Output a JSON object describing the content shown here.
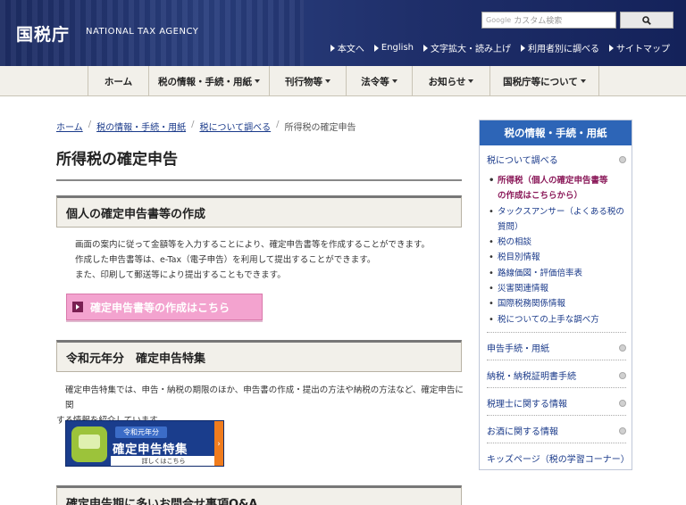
{
  "header": {
    "logo_jp": "国税庁",
    "logo_en": "NATIONAL TAX AGENCY",
    "search": {
      "brand": "Google",
      "placeholder": "カスタム検索",
      "button_icon": "search-icon"
    },
    "utility_links": [
      "本文へ",
      "English",
      "文字拡大・読み上げ",
      "利用者別に調べる",
      "サイトマップ"
    ]
  },
  "gnav": {
    "items": [
      {
        "label": "ホーム",
        "dropdown": false
      },
      {
        "label": "税の情報・手続・用紙",
        "dropdown": true
      },
      {
        "label": "刊行物等",
        "dropdown": true
      },
      {
        "label": "法令等",
        "dropdown": true
      },
      {
        "label": "お知らせ",
        "dropdown": true
      },
      {
        "label": "国税庁等について",
        "dropdown": true
      }
    ]
  },
  "breadcrumb": [
    "ホーム",
    "税の情報・手続・用紙",
    "税について調べる",
    "所得税の確定申告"
  ],
  "page_title": "所得税の確定申告",
  "section1": {
    "heading": "個人の確定申告書等の作成",
    "lines": [
      "画面の案内に従って金額等を入力することにより、確定申告書等を作成することができます。",
      "作成した申告書等は、e-Tax（電子申告）を利用して提出することができます。",
      "また、印刷して郵送等により提出することもできます。"
    ],
    "button": "確定申告書等の作成はこちら"
  },
  "section2": {
    "heading": "令和元年分　確定申告特集",
    "text_line1": "確定申告特集では、申告・納税の期限のほか、申告書の作成・提出の方法や納税の方法など、確定申告に関",
    "text_line2": "する情報を紹介しています。",
    "banner": {
      "tag": "令和元年分",
      "title": "確定申告特集",
      "sub": "詳しくはこちら",
      "arrow": "›"
    }
  },
  "section3": {
    "heading": "確定申告期に多いお問合せ事項Q&A"
  },
  "sidebar": {
    "title": "税の情報・手続・用紙",
    "top_item": "税について調べる",
    "sub_items": [
      {
        "line1": "所得税（個人の確定申告書等",
        "line2": "の作成はこちらから）",
        "active": true
      },
      {
        "line1": "タックスアンサー（よくある税の",
        "line2": "質問）",
        "active": false
      },
      {
        "line1": "税の相談",
        "line2": "",
        "active": false
      },
      {
        "line1": "税目別情報",
        "line2": "",
        "active": false
      },
      {
        "line1": "路線価図・評価倍率表",
        "line2": "",
        "active": false
      },
      {
        "line1": "災害関連情報",
        "line2": "",
        "active": false
      },
      {
        "line1": "国際税務関係情報",
        "line2": "",
        "active": false
      },
      {
        "line1": "税についての上手な調べ方",
        "line2": "",
        "active": false
      }
    ],
    "items": [
      "申告手続・用紙",
      "納税・納税証明書手続",
      "税理士に関する情報",
      "お酒に関する情報",
      "キッズページ（税の学習コーナー）"
    ],
    "colors": {
      "accent": "#2d65b7",
      "active": "#8b1a5a"
    }
  }
}
